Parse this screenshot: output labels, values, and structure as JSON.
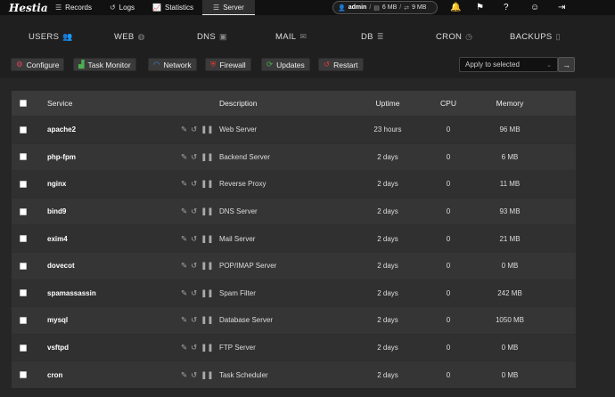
{
  "top_nav": {
    "logo": "Hestia",
    "items": [
      {
        "label": "Records",
        "icon": "list-icon"
      },
      {
        "label": "Logs",
        "icon": "history-icon"
      },
      {
        "label": "Statistics",
        "icon": "chart-icon"
      },
      {
        "label": "Server",
        "icon": "server-menu-icon",
        "active": true
      }
    ],
    "user": {
      "name": "admin",
      "disk": "6 MB",
      "bandwidth": "9 MB"
    }
  },
  "categories": [
    {
      "label": "USERS",
      "icon": "users-icon"
    },
    {
      "label": "WEB",
      "icon": "globe-icon"
    },
    {
      "label": "DNS",
      "icon": "dns-book-icon"
    },
    {
      "label": "MAIL",
      "icon": "mail-icon"
    },
    {
      "label": "DB",
      "icon": "database-icon"
    },
    {
      "label": "CRON",
      "icon": "clock-icon"
    },
    {
      "label": "BACKUPS",
      "icon": "file-icon"
    }
  ],
  "toolbar": {
    "buttons": [
      {
        "label": "Configure",
        "icon": "gear-icon",
        "color": "#e0455c"
      },
      {
        "label": "Task Monitor",
        "icon": "chart-icon",
        "color": "#4caf50"
      },
      {
        "label": "Network",
        "icon": "network-icon",
        "color": "#3d8bea"
      },
      {
        "label": "Firewall",
        "icon": "shield-icon",
        "color": "#e53935"
      },
      {
        "label": "Updates",
        "icon": "refresh-icon",
        "color": "#4caf50"
      },
      {
        "label": "Restart",
        "icon": "undo-icon",
        "color": "#e53935"
      }
    ],
    "bulk_action": {
      "value": "Apply to selected"
    }
  },
  "table": {
    "headers": {
      "service": "Service",
      "description": "Description",
      "uptime": "Uptime",
      "cpu": "CPU",
      "memory": "Memory"
    },
    "rows": [
      {
        "service": "apache2",
        "description": "Web Server",
        "uptime": "23 hours",
        "cpu": "0",
        "memory": "96 MB"
      },
      {
        "service": "php-fpm",
        "description": "Backend Server",
        "uptime": "2 days",
        "cpu": "0",
        "memory": "6 MB"
      },
      {
        "service": "nginx",
        "description": "Reverse Proxy",
        "uptime": "2 days",
        "cpu": "0",
        "memory": "11 MB"
      },
      {
        "service": "bind9",
        "description": "DNS Server",
        "uptime": "2 days",
        "cpu": "0",
        "memory": "93 MB"
      },
      {
        "service": "exim4",
        "description": "Mail Server",
        "uptime": "2 days",
        "cpu": "0",
        "memory": "21 MB"
      },
      {
        "service": "dovecot",
        "description": "POP/IMAP Server",
        "uptime": "2 days",
        "cpu": "0",
        "memory": "0 MB"
      },
      {
        "service": "spamassassin",
        "description": "Spam Filter",
        "uptime": "2 days",
        "cpu": "0",
        "memory": "242 MB"
      },
      {
        "service": "mysql",
        "description": "Database Server",
        "uptime": "2 days",
        "cpu": "0",
        "memory": "1050 MB"
      },
      {
        "service": "vsftpd",
        "description": "FTP Server",
        "uptime": "2 days",
        "cpu": "0",
        "memory": "0 MB"
      },
      {
        "service": "cron",
        "description": "Task Scheduler",
        "uptime": "2 days",
        "cpu": "0",
        "memory": "0 MB"
      }
    ]
  }
}
